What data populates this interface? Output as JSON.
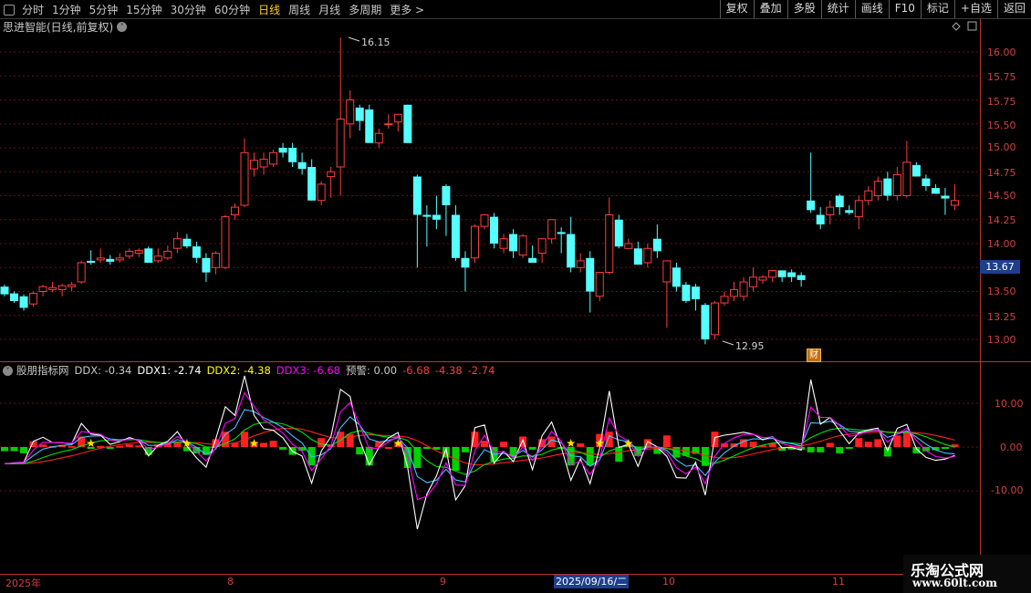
{
  "toolbar": {
    "periods": [
      "分时",
      "1分钟",
      "5分钟",
      "15分钟",
      "30分钟",
      "60分钟",
      "日线",
      "周线",
      "月线",
      "多周期",
      "更多 >"
    ],
    "active_index": 6,
    "buttons": [
      "复权",
      "叠加",
      "多股",
      "统计",
      "画线",
      "F10",
      "标记",
      "+自选",
      "返回"
    ]
  },
  "main_chart": {
    "title": "思进智能(日线,前复权)",
    "y_ticks": [
      "16.00",
      "15.75",
      "15.50",
      "15.25",
      "15.00",
      "14.75",
      "14.50",
      "14.25",
      "14.00",
      "13.75",
      "13.50",
      "13.25",
      "13.00"
    ],
    "high_label": "16.15",
    "low_label": "12.95",
    "last_price": "13.67",
    "cai_tag": "财"
  },
  "indicator": {
    "name": "股朋指标网",
    "ddx_label": "DDX: -0.34",
    "ddx1_label": "DDX1: -2.74",
    "ddx2_label": "DDX2: -4.38",
    "ddx3_label": "DDX3: -6.68",
    "alert_label": "预警: 0.00",
    "v1": "-6.68",
    "v2": "-4.38",
    "v3": "-2.74",
    "y_ticks": [
      "10.00",
      "0.00",
      "-10.00"
    ]
  },
  "dates": {
    "year": "2025年",
    "m8": "8",
    "m9": "9",
    "selected": "2025/09/16/二",
    "m10": "10",
    "m11": "11"
  },
  "watermark": {
    "line1": "乐淘公式网",
    "line2": "www.60lt.com"
  },
  "colors": {
    "up": "#ff3c3c",
    "down": "#54ffff",
    "ddx1": "#ffffff",
    "ddx2": "#ffff00",
    "ddx3": "#ff00ff"
  },
  "chart_data": {
    "type": "candlestick",
    "ohlc": [
      [
        13.55,
        13.57,
        13.45,
        13.47
      ],
      [
        13.48,
        13.5,
        13.38,
        13.4
      ],
      [
        13.45,
        13.47,
        13.3,
        13.33
      ],
      [
        13.37,
        13.5,
        13.34,
        13.48
      ],
      [
        13.5,
        13.57,
        13.45,
        13.55
      ],
      [
        13.52,
        13.6,
        13.49,
        13.54
      ],
      [
        13.52,
        13.58,
        13.45,
        13.56
      ],
      [
        13.55,
        13.6,
        13.5,
        13.57
      ],
      [
        13.6,
        13.82,
        13.58,
        13.8
      ],
      [
        13.82,
        13.93,
        13.78,
        13.8
      ],
      [
        13.83,
        13.95,
        13.8,
        13.85
      ],
      [
        13.84,
        13.88,
        13.78,
        13.81
      ],
      [
        13.83,
        13.9,
        13.8,
        13.85
      ],
      [
        13.87,
        13.95,
        13.84,
        13.92
      ],
      [
        13.9,
        13.95,
        13.86,
        13.93
      ],
      [
        13.95,
        13.97,
        13.8,
        13.8
      ],
      [
        13.82,
        13.95,
        13.8,
        13.87
      ],
      [
        13.85,
        13.98,
        13.83,
        13.92
      ],
      [
        13.95,
        14.12,
        13.9,
        14.05
      ],
      [
        14.05,
        14.1,
        13.95,
        13.97
      ],
      [
        13.97,
        14.02,
        13.8,
        13.85
      ],
      [
        13.85,
        13.9,
        13.6,
        13.7
      ],
      [
        13.75,
        13.92,
        13.68,
        13.9
      ],
      [
        13.75,
        14.3,
        13.73,
        14.28
      ],
      [
        14.3,
        14.42,
        14.25,
        14.38
      ],
      [
        14.4,
        15.1,
        14.38,
        14.95
      ],
      [
        14.78,
        14.95,
        14.7,
        14.87
      ],
      [
        14.8,
        14.95,
        14.72,
        14.88
      ],
      [
        14.83,
        14.98,
        14.8,
        14.95
      ],
      [
        15.0,
        15.05,
        14.9,
        14.95
      ],
      [
        15.0,
        15.05,
        14.8,
        14.85
      ],
      [
        14.85,
        14.95,
        14.72,
        14.78
      ],
      [
        14.8,
        14.88,
        14.45,
        14.45
      ],
      [
        14.45,
        14.65,
        14.4,
        14.62
      ],
      [
        14.7,
        14.8,
        14.48,
        14.75
      ],
      [
        14.8,
        16.15,
        14.5,
        15.3
      ],
      [
        15.25,
        15.6,
        15.1,
        15.5
      ],
      [
        15.42,
        15.45,
        15.18,
        15.28
      ],
      [
        15.4,
        15.45,
        15.05,
        15.05
      ],
      [
        15.05,
        15.2,
        15.0,
        15.15
      ],
      [
        15.25,
        15.35,
        15.2,
        15.25
      ],
      [
        15.27,
        15.35,
        15.17,
        15.35
      ],
      [
        15.45,
        15.45,
        15.05,
        15.05
      ],
      [
        14.7,
        14.72,
        13.75,
        14.3
      ],
      [
        14.3,
        14.4,
        13.97,
        14.28
      ],
      [
        14.3,
        14.5,
        14.15,
        14.25
      ],
      [
        14.6,
        14.62,
        14.08,
        14.4
      ],
      [
        14.3,
        14.4,
        13.82,
        13.85
      ],
      [
        13.85,
        13.92,
        13.5,
        13.75
      ],
      [
        13.85,
        14.2,
        13.8,
        14.18
      ],
      [
        14.18,
        14.3,
        14.15,
        14.3
      ],
      [
        14.28,
        14.32,
        13.95,
        14.0
      ],
      [
        13.95,
        14.1,
        13.9,
        14.05
      ],
      [
        14.1,
        14.15,
        13.85,
        13.92
      ],
      [
        13.88,
        14.1,
        13.85,
        14.08
      ],
      [
        13.85,
        13.98,
        13.8,
        13.8
      ],
      [
        13.9,
        14.05,
        13.8,
        14.05
      ],
      [
        14.05,
        14.25,
        14.0,
        14.25
      ],
      [
        14.12,
        14.17,
        13.9,
        14.1
      ],
      [
        14.1,
        14.28,
        13.7,
        13.75
      ],
      [
        13.75,
        13.9,
        13.7,
        13.82
      ],
      [
        13.85,
        13.92,
        13.28,
        13.5
      ],
      [
        13.45,
        13.6,
        13.4,
        13.7
      ],
      [
        13.7,
        14.48,
        13.68,
        14.3
      ],
      [
        14.25,
        14.3,
        13.95,
        13.97
      ],
      [
        13.95,
        14.05,
        13.95,
        14.0
      ],
      [
        13.95,
        14.02,
        13.78,
        13.78
      ],
      [
        13.8,
        14.0,
        13.75,
        13.95
      ],
      [
        14.05,
        14.2,
        13.85,
        13.92
      ],
      [
        13.6,
        13.65,
        13.12,
        13.82
      ],
      [
        13.75,
        13.8,
        13.5,
        13.55
      ],
      [
        13.57,
        13.6,
        13.38,
        13.4
      ],
      [
        13.55,
        13.58,
        13.3,
        13.42
      ],
      [
        13.36,
        13.38,
        12.95,
        13.0
      ],
      [
        13.05,
        13.4,
        13.0,
        13.38
      ],
      [
        13.38,
        13.5,
        13.35,
        13.45
      ],
      [
        13.45,
        13.6,
        13.4,
        13.52
      ],
      [
        13.45,
        13.65,
        13.4,
        13.6
      ],
      [
        13.55,
        13.75,
        13.5,
        13.65
      ],
      [
        13.62,
        13.67,
        13.58,
        13.65
      ],
      [
        13.65,
        13.72,
        13.6,
        13.72
      ],
      [
        13.72,
        13.72,
        13.6,
        13.65
      ],
      [
        13.7,
        13.73,
        13.6,
        13.65
      ],
      [
        13.67,
        13.7,
        13.55,
        13.62
      ],
      [
        14.45,
        14.95,
        14.32,
        14.35
      ],
      [
        14.3,
        14.38,
        14.15,
        14.2
      ],
      [
        14.3,
        14.45,
        14.2,
        14.38
      ],
      [
        14.5,
        14.52,
        14.3,
        14.38
      ],
      [
        14.35,
        14.4,
        14.3,
        14.32
      ],
      [
        14.28,
        14.5,
        14.15,
        14.45
      ],
      [
        14.45,
        14.6,
        14.4,
        14.55
      ],
      [
        14.5,
        14.7,
        14.45,
        14.65
      ],
      [
        14.68,
        14.75,
        14.45,
        14.5
      ],
      [
        14.5,
        14.8,
        14.45,
        14.72
      ],
      [
        14.5,
        15.07,
        14.48,
        14.85
      ],
      [
        14.82,
        14.85,
        14.7,
        14.7
      ],
      [
        14.68,
        14.72,
        14.55,
        14.6
      ],
      [
        14.58,
        14.62,
        14.52,
        14.52
      ],
      [
        14.5,
        14.58,
        14.3,
        14.47
      ],
      [
        14.4,
        14.62,
        14.35,
        14.45
      ]
    ],
    "indicator_y_range": [
      -28,
      19
    ]
  }
}
